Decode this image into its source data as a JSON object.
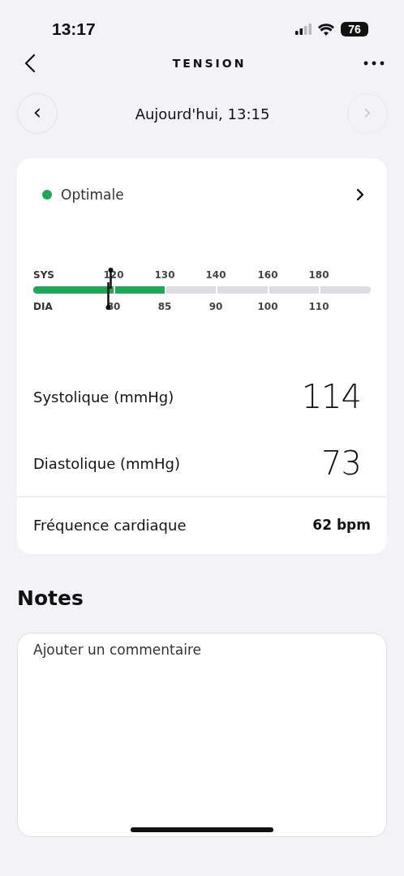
{
  "status_bar": {
    "time": "13:17",
    "battery": "76"
  },
  "nav": {
    "title": "TENSION"
  },
  "date_nav": {
    "label": "Aujourd'hui, 13:15",
    "prev": {
      "symbol": "‹",
      "disabled": false
    },
    "next": {
      "symbol": "›",
      "disabled": true
    }
  },
  "card": {
    "status": {
      "label": "Optimale",
      "color": "#1fa855"
    },
    "scale": {
      "sys_label": "SYS",
      "dia_label": "DIA",
      "sys_ticks": [
        "120",
        "130",
        "140",
        "160",
        "180"
      ],
      "dia_ticks": [
        "80",
        "85",
        "90",
        "100",
        "110"
      ],
      "fill": {
        "level": 0.39
      },
      "marker": {
        "level": 0.225
      }
    },
    "readings": [
      {
        "label": "Systolique (mmHg)",
        "value": "114"
      },
      {
        "label": "Diastolique (mmHg)",
        "value": "73"
      }
    ],
    "heart_rate": {
      "label": "Fréquence cardiaque",
      "value": "62 bpm"
    }
  },
  "notes": {
    "title": "Notes",
    "placeholder": "Ajouter un commentaire"
  }
}
